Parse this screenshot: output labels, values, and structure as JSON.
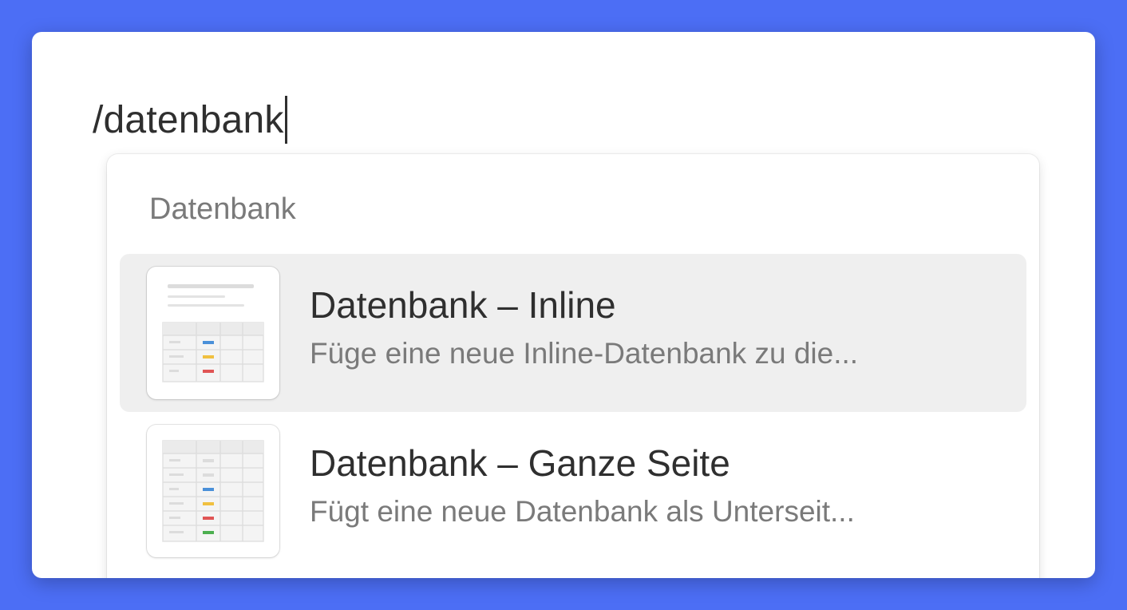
{
  "editor": {
    "typed_text": "/datenbank"
  },
  "menu": {
    "heading": "Datenbank",
    "items": [
      {
        "title": "Datenbank – Inline",
        "description": "Füge eine neue Inline-Datenbank zu die...",
        "icon": "inline-database-thumbnail-icon",
        "selected": true
      },
      {
        "title": "Datenbank – Ganze Seite",
        "description": "Fügt eine neue Datenbank als Unterseit...",
        "icon": "full-page-database-thumbnail-icon",
        "selected": false
      }
    ]
  },
  "colors": {
    "background": "#4c6ef5",
    "selected_row": "#efefef",
    "tag_blue": "#4a90d9",
    "tag_yellow": "#f0c040",
    "tag_red": "#e05555",
    "tag_green": "#4caf50"
  }
}
